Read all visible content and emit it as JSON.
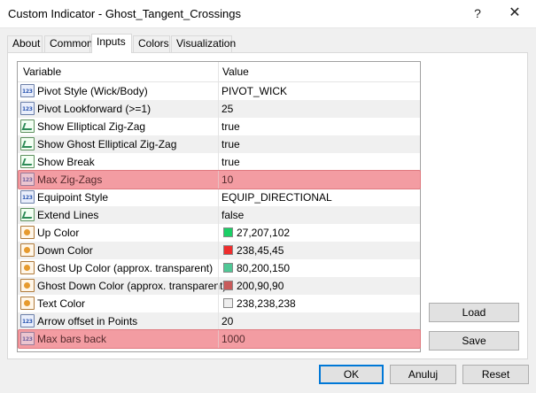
{
  "window": {
    "title": "Custom Indicator - Ghost_Tangent_Crossings",
    "help_glyph": "?",
    "close_glyph": "✕"
  },
  "tabs": [
    {
      "label": "About"
    },
    {
      "label": "Common"
    },
    {
      "label": "Inputs"
    },
    {
      "label": "Colors"
    },
    {
      "label": "Visualization"
    }
  ],
  "active_tab": "Inputs",
  "grid": {
    "header": {
      "variable": "Variable",
      "value": "Value"
    },
    "rows": [
      {
        "icon": "number-icon",
        "variable": "Pivot Style (Wick/Body)",
        "value": "PIVOT_WICK"
      },
      {
        "icon": "number-icon",
        "variable": "Pivot Lookforward (>=1)",
        "value": "25"
      },
      {
        "icon": "boolean-icon",
        "variable": "Show Elliptical Zig-Zag",
        "value": "true"
      },
      {
        "icon": "boolean-icon",
        "variable": "Show Ghost Elliptical Zig-Zag",
        "value": "true"
      },
      {
        "icon": "boolean-icon",
        "variable": "Show Break",
        "value": "true"
      },
      {
        "icon": "number-icon",
        "variable": "Max Zig-Zags",
        "value": "10",
        "highlighted": true
      },
      {
        "icon": "number-icon",
        "variable": "Equipoint Style",
        "value": "EQUIP_DIRECTIONAL"
      },
      {
        "icon": "boolean-icon",
        "variable": "Extend Lines",
        "value": "false"
      },
      {
        "icon": "color-icon",
        "variable": "Up Color",
        "value": "27,207,102",
        "swatch": "#1bcf66"
      },
      {
        "icon": "color-icon",
        "variable": "Down Color",
        "value": "238,45,45",
        "swatch": "#ee2d2d"
      },
      {
        "icon": "color-icon",
        "variable": "Ghost Up Color (approx. transparent)",
        "value": "80,200,150",
        "swatch": "#50c896"
      },
      {
        "icon": "color-icon",
        "variable": "Ghost Down Color (approx. transparent)",
        "value": "200,90,90",
        "swatch": "#c85a5a"
      },
      {
        "icon": "color-icon",
        "variable": "Text Color",
        "value": "238,238,238",
        "swatch": "#eeeeee"
      },
      {
        "icon": "number-icon",
        "variable": "Arrow offset in Points",
        "value": "20"
      },
      {
        "icon": "number-icon",
        "variable": "Max bars back",
        "value": "1000",
        "highlighted": true
      }
    ]
  },
  "side_buttons": {
    "load": "Load",
    "save": "Save"
  },
  "footer_buttons": {
    "ok": "OK",
    "cancel": "Anuluj",
    "reset": "Reset"
  },
  "colors": {
    "highlight": "#f4b0b4",
    "accent": "#0078d7",
    "row_alt": "#f0f0f0"
  }
}
